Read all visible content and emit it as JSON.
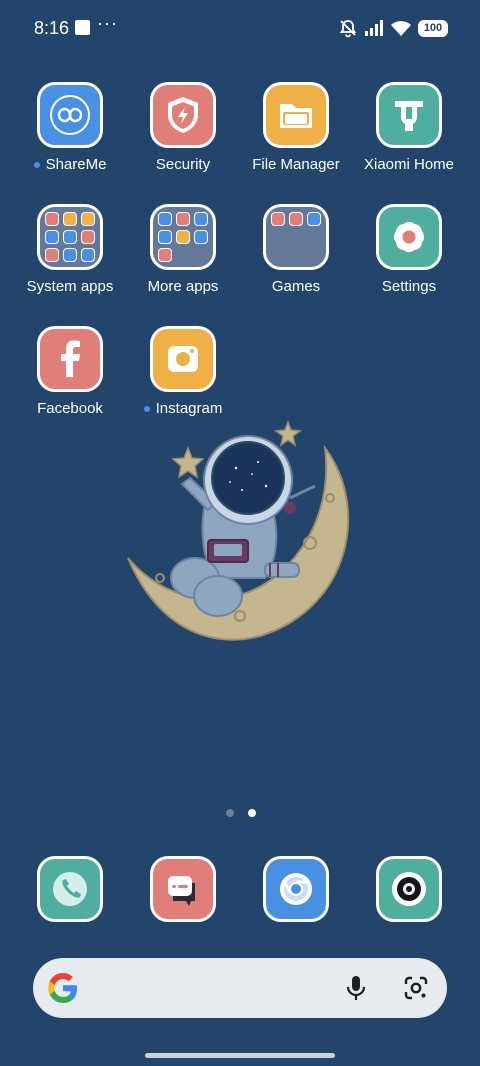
{
  "status_bar": {
    "time": "8:16",
    "overflow": "···",
    "battery": "100",
    "icons": [
      "notification-square-icon",
      "mute-bell-icon",
      "signal-icon",
      "wifi-icon",
      "battery-icon"
    ]
  },
  "apps": [
    {
      "label": "ShareMe",
      "icon": "infinity-share-icon",
      "color": "#4a90e2",
      "new_dot": true
    },
    {
      "label": "Security",
      "icon": "shield-bolt-icon",
      "color": "#e07e7a",
      "new_dot": false
    },
    {
      "label": "File Manager",
      "icon": "folder-icon",
      "color": "#f0b048",
      "new_dot": false
    },
    {
      "label": "Xiaomi Home",
      "icon": "mi-home-icon",
      "color": "#4fae9e",
      "new_dot": false
    },
    {
      "label": "System apps",
      "icon": "folder-system-apps",
      "color": "#64799a",
      "new_dot": false
    },
    {
      "label": "More apps",
      "icon": "folder-more-apps",
      "color": "#64799a",
      "new_dot": false
    },
    {
      "label": "Games",
      "icon": "folder-games",
      "color": "#64799a",
      "new_dot": false
    },
    {
      "label": "Settings",
      "icon": "gear-flower-icon",
      "color": "#4fae9e",
      "new_dot": false
    },
    {
      "label": "Facebook",
      "icon": "facebook-f-icon",
      "color": "#e07e7a",
      "new_dot": false
    },
    {
      "label": "Instagram",
      "icon": "instagram-camera-icon",
      "color": "#f0b048",
      "new_dot": true
    }
  ],
  "pager": {
    "pages": 2,
    "current": 2
  },
  "dock": [
    {
      "name": "phone",
      "icon": "phone-icon",
      "color": "#4fae9e"
    },
    {
      "name": "messages",
      "icon": "chat-icon",
      "color": "#e07e7a"
    },
    {
      "name": "browser",
      "icon": "chrome-icon",
      "color": "#4a90e2"
    },
    {
      "name": "camera",
      "icon": "camera-lens-icon",
      "color": "#4fae9e"
    }
  ],
  "search": {
    "logo": "google-g-icon",
    "mic": "microphone-icon",
    "lens": "google-lens-icon"
  }
}
